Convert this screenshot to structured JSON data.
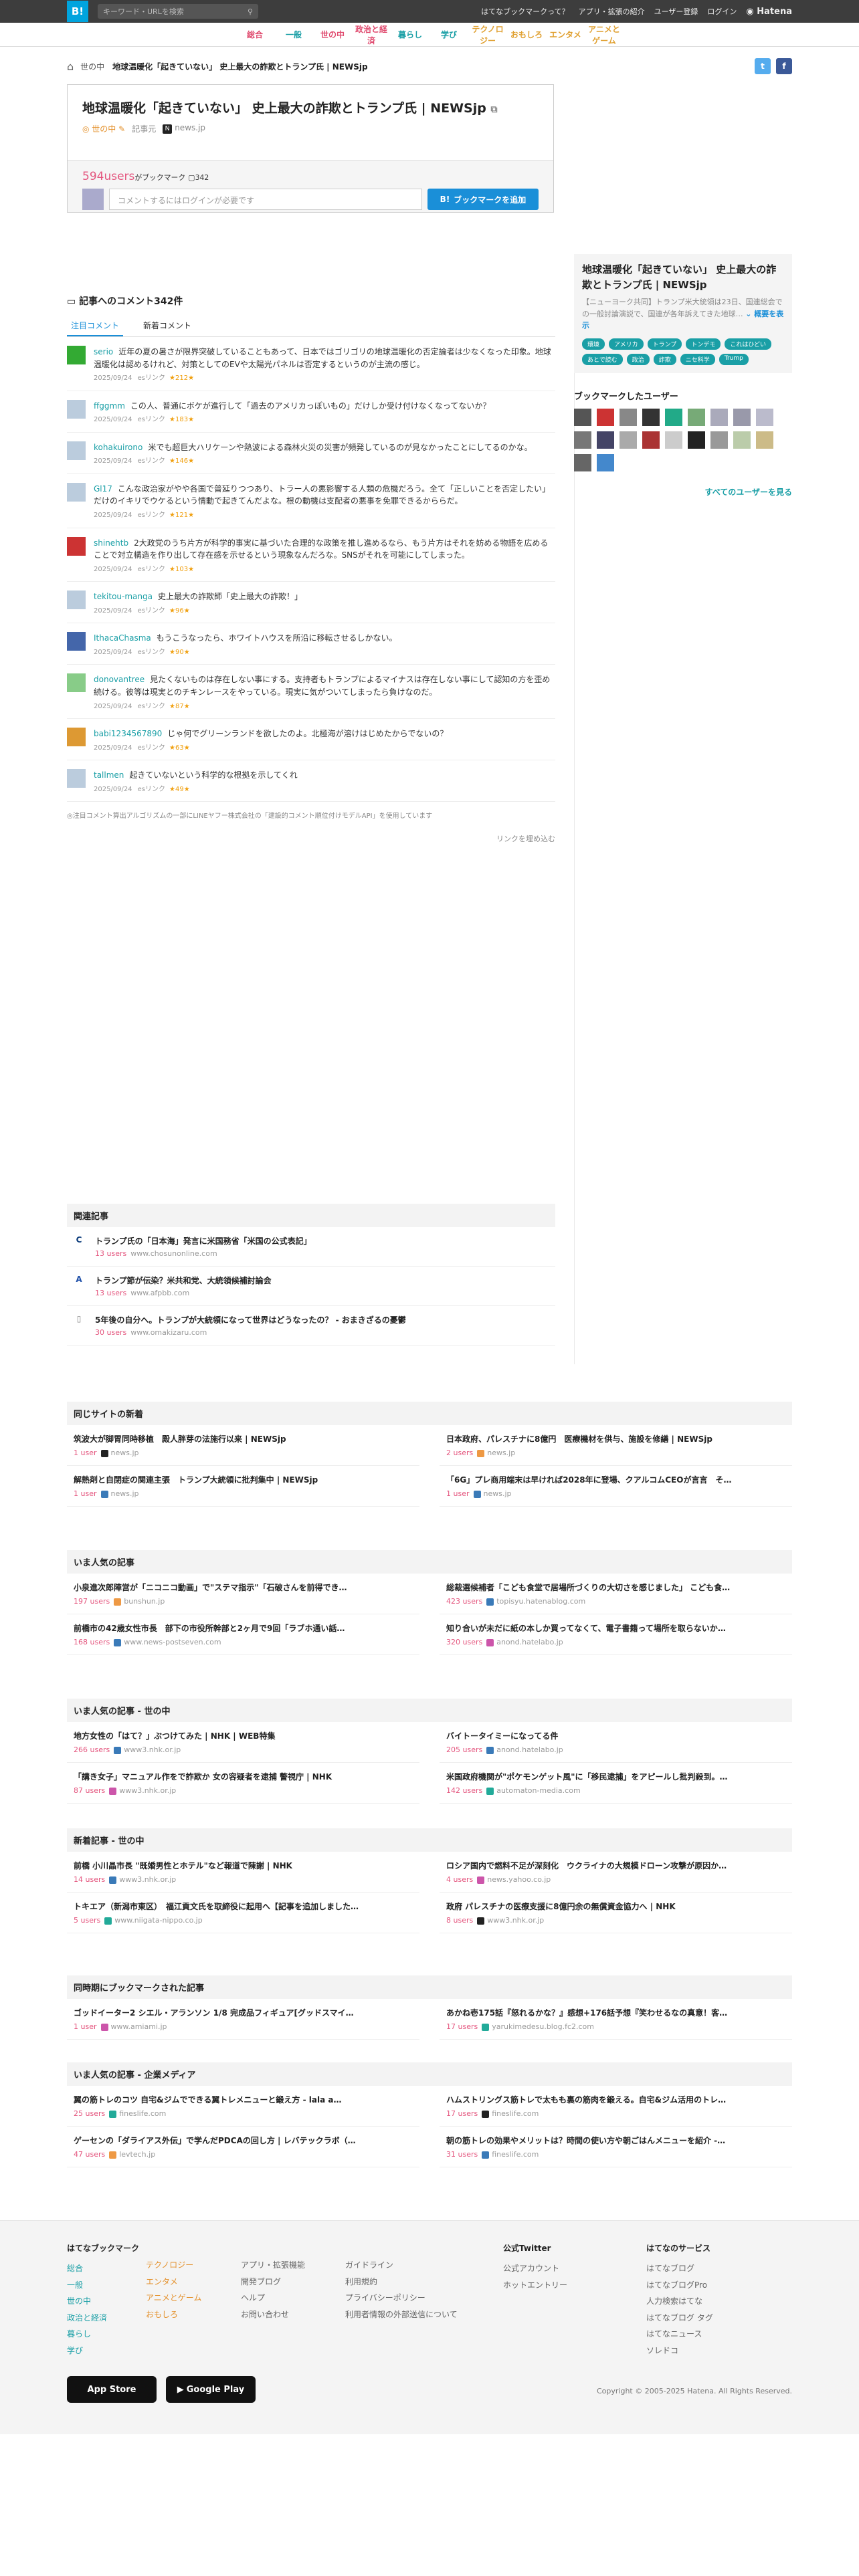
{
  "topbar": {
    "logo": "B!",
    "search_placeholder": "キーワード・URLを検索",
    "links": [
      "はてなブックマークって？",
      "アプリ・拡張の紹介",
      "ユーザー登録",
      "ログイン"
    ],
    "hatena": "Hatena"
  },
  "categories": [
    "総合",
    "一般",
    "世の中",
    "政治と経済",
    "暮らし",
    "学び",
    "テクノロジー",
    "おもしろ",
    "エンタメ",
    "アニメとゲーム"
  ],
  "category_colors": [
    "#e04b6f",
    "#1a9fa6",
    "#e04b6f",
    "#e04b6f",
    "#1a9fa6",
    "#1a9fa6",
    "#e0a030",
    "#e0a030",
    "#e0a030",
    "#e0a030"
  ],
  "breadcrumb": {
    "crumb": "世の中",
    "title": "地球温暖化「起きていない」 史上最大の詐欺とトランプ氏 | NEWSjp"
  },
  "article": {
    "title": "地球温暖化「起きていない」 史上最大の詐欺とトランプ氏 | NEWSjp",
    "category": "世の中",
    "kijichu": "記事元",
    "source": "news.jp",
    "users": "594users",
    "users_label": "がブックマーク",
    "comment_count": "342",
    "comment_placeholder": "コメントするにはログインが必要です",
    "add_button": "ブックマークを追加"
  },
  "sidebar": {
    "title": "地球温暖化「起きていない」 史上最大の詐欺とトランプ氏 | NEWSjp",
    "summary": "【ニューヨーク共同】トランプ米大統領は23日、国連総会での一般討論演説で、国連が各年訴えてきた地球…",
    "summary_link": "概要を表示",
    "tags": [
      "環境",
      "アメリカ",
      "トランプ",
      "トンデモ",
      "これはひどい",
      "あとで読む",
      "政治",
      "詐欺",
      "ニセ科学",
      "Trump"
    ],
    "users_heading": "ブックマークしたユーザー",
    "see_all": "すべてのユーザーを見る"
  },
  "comments": {
    "heading": "記事へのコメント342件",
    "tabs": [
      "注目コメント",
      "新着コメント"
    ],
    "items": [
      {
        "user": "serio",
        "text": "近年の夏の暑さが限界突破していることもあって、日本ではゴリゴリの地球温暖化の否定論者は少なくなった印象。地球温暖化は認めるけれど、対策としてのEVや太陽光パネルは否定するというのが主流の感じ。",
        "date": "2025/09/24",
        "stars": "★212★"
      },
      {
        "user": "ffggmm",
        "text": "この人、普通にボケが進行して「過去のアメリカっぽいもの」だけしか受け付けなくなってないか？",
        "date": "2025/09/24",
        "stars": "★183★"
      },
      {
        "user": "kohakuirono",
        "text": "米でも超巨大ハリケーンや熱波による森林火災の災害が頻発しているのが見なかったことにしてるのかな。",
        "date": "2025/09/24",
        "stars": "★146★"
      },
      {
        "user": "Gl17",
        "text": "こんな政治家がやや各国で普延りつつあり、トラー人の悪影響する人類の危機だろう。全て「正しいことを否定したい」だけのイキリでウケるという情動で起きてんだよな。根の動機は支配者の悪事を免罪できるかららだ。",
        "date": "2025/09/24",
        "stars": "★121★"
      },
      {
        "user": "shinehtb",
        "text": "2大政党のうち片方が科学的事実に基づいた合理的な政策を推し進めるなら、もう片方はそれを妨める物語を広めることで対立構造を作り出して存在感を示せるという現象なんだろな。SNSがそれを可能にしてしまった。",
        "date": "2025/09/24",
        "stars": "★103★"
      },
      {
        "user": "tekitou-manga",
        "text": "史上最大の詐欺師「史上最大の詐欺！」",
        "date": "2025/09/24",
        "stars": "★96★"
      },
      {
        "user": "IthacaChasma",
        "text": "もうこうなったら、ホワイトハウスを所沿に移転させるしかない。",
        "date": "2025/09/24",
        "stars": "★90★"
      },
      {
        "user": "donovantree",
        "text": "見たくないものは存在しない事にする。支持者もトランプによるマイナスは存在しない事にして認知の方を歪め続ける。彼等は現実とのチキンレースをやっている。現実に気がついてしまったら負けなのだ。",
        "date": "2025/09/24",
        "stars": "★87★"
      },
      {
        "user": "babi1234567890",
        "text": "じゃ何でグリーンランドを欲したのよ。北極海が溶けはじめたからでないの？",
        "date": "2025/09/24",
        "stars": "★63★"
      },
      {
        "user": "tallmen",
        "text": "起きていないという科学的な根拠を示してくれ",
        "date": "2025/09/24",
        "stars": "★49★"
      }
    ],
    "link_label": "esリンク",
    "note": "◎注目コメント算出アルゴリズムの一部にLINEヤフー株式会社の「建設的コメント順位付けモデルAPI」を使用しています",
    "more": "リンクを埋め込む"
  },
  "related": {
    "heading": "関連記事",
    "items": [
      {
        "title": "トランプ氏の「日本海」発言に米国務省「米国の公式表記」",
        "users": "13 users",
        "site": "www.chosunonline.com"
      },
      {
        "title": "トランプ節が伝染？米共和党、大統領候補討論会",
        "users": "13 users",
        "site": "www.afpbb.com"
      },
      {
        "title": "5年後の自分へ。トランプが大統領になって世界はどうなったの？ - おまきざるの憂鬱",
        "users": "30 users",
        "site": "www.omakizaru.com"
      }
    ]
  },
  "sections": [
    {
      "heading": "同じサイトの新着",
      "items": [
        {
          "title": "筑波大が脚胃同時移植　殿人胖芽の法施行以来 | NEWSjp",
          "users": "1 user",
          "site": "news.jp"
        },
        {
          "title": "日本政府、パレスチナに8億円　医療機材を供与、施設を修繕 | NEWSjp",
          "users": "2 users",
          "site": "news.jp"
        },
        {
          "title": "解熱剤と自閉症の関連主張　トランプ大統領に批判集中 | NEWSjp",
          "users": "1 user",
          "site": "news.jp"
        },
        {
          "title": "「6G」プレ商用端末は早ければ2028年に登場、クアルコムCEOが言言　そ…",
          "users": "1 user",
          "site": "news.jp"
        }
      ]
    },
    {
      "heading": "いま人気の記事",
      "items": [
        {
          "title": "小泉進次郎陣営が「ニコニコ動画」で\"ステマ指示\"「石破さんを前得でき…",
          "users": "197 users",
          "site": "bunshun.jp"
        },
        {
          "title": "総裁選候補者「こども食堂で居場所づくりの大切さを感じました」 こども食…",
          "users": "423 users",
          "site": "topisyu.hatenablog.com"
        },
        {
          "title": "前橋市の42歳女性市長　部下の市役所幹部と2ヶ月で9回「ラブホ通い話…",
          "users": "168 users",
          "site": "www.news-postseven.com"
        },
        {
          "title": "知り合いが未だに紙の本しか買ってなくて、電子書籍って場所を取らないか…",
          "users": "320 users",
          "site": "anond.hatelabo.jp"
        }
      ]
    },
    {
      "heading": "いま人気の記事 - 世の中",
      "items": [
        {
          "title": "地方女性の「はて？」ぶつけてみた | NHK | WEB特集",
          "users": "266 users",
          "site": "www3.nhk.or.jp"
        },
        {
          "title": "バイトータイミーになってる件",
          "users": "205 users",
          "site": "anond.hatelabo.jp"
        },
        {
          "title": "「講き女子」マニュアル作をで詐欺か 女の容疑者を逮捕 警視庁 | NHK",
          "users": "87 users",
          "site": "www3.nhk.or.jp"
        },
        {
          "title": "米国政府機関が\"ポケモンゲット風\"に「移民逮捕」をアピールし批判殺到。…",
          "users": "142 users",
          "site": "automaton-media.com"
        }
      ]
    },
    {
      "heading": "新着記事 - 世の中",
      "items": [
        {
          "title": "前橋 小川晶市長 \"既婚男性とホテル\"など報道で陳謝 | NHK",
          "users": "14 users",
          "site": "www3.nhk.or.jp"
        },
        {
          "title": "ロシア国内で燃料不足が深刻化　ウクライナの大規模ドローン攻撃が原因か…",
          "users": "4 users",
          "site": "news.yahoo.co.jp"
        },
        {
          "title": "トキエア（新潟市東区）　福江貢文氏を取締役に起用へ【記事を追加しました…",
          "users": "5 users",
          "site": "www.niigata-nippo.co.jp"
        },
        {
          "title": "政府 パレスチナの医療支援に8億円余の無償資金協力へ | NHK",
          "users": "8 users",
          "site": "www3.nhk.or.jp"
        }
      ]
    },
    {
      "heading": "同時期にブックマークされた記事",
      "items": [
        {
          "title": "ゴッドイーター2 シエル・アランソン 1/8 完成品フィギュア[グッドスマイ…",
          "users": "1 user",
          "site": "www.amiami.jp"
        },
        {
          "title": "あかね壱175話『怒れるかな？』感想+176話予想『笑わせるなの真意！客…",
          "users": "17 users",
          "site": "yarukimedesu.blog.fc2.com"
        }
      ]
    },
    {
      "heading": "いま人気の記事 - 企業メディア",
      "items": [
        {
          "title": "翼の筋トレのコツ 自宅&ジムでできる翼トレメニューと鍛え方 - lala a…",
          "users": "25 users",
          "site": "fineslife.com"
        },
        {
          "title": "ハムストリングス筋トレで太もも裏の筋肉を鍛える。自宅&ジム活用のトレ…",
          "users": "17 users",
          "site": "fineslife.com"
        },
        {
          "title": "ゲーセンの「ダライアス外伝」で学んだPDCAの回し方 | レバテックラボ（…",
          "users": "47 users",
          "site": "levtech.jp"
        },
        {
          "title": "朝の筋トレの効果やメリットは？時間の使い方や朝ごはんメニューを紹介 -…",
          "users": "31 users",
          "site": "fineslife.com"
        }
      ]
    }
  ],
  "footer": {
    "col1_heading": "はてなブックマーク",
    "col1a": [
      "総合",
      "一般",
      "世の中",
      "政治と経済",
      "暮らし",
      "学び"
    ],
    "col1b": [
      "テクノロジー",
      "エンタメ",
      "アニメとゲーム",
      "おもしろ"
    ],
    "col2": [
      "アプリ・拡張機能",
      "開発ブログ",
      "ヘルプ",
      "お問い合わせ"
    ],
    "col3": [
      "ガイドライン",
      "利用規約",
      "プライバシーポリシー",
      "利用者情報の外部送信について"
    ],
    "col4_heading": "公式Twitter",
    "col4": [
      "公式アカウント",
      "ホットエントリー"
    ],
    "col5_heading": "はてなのサービス",
    "col5": [
      "はてなブログ",
      "はてなブログPro",
      "人力検索はてな",
      "はてなブログ タグ",
      "はてなニュース",
      "ソレドコ"
    ],
    "appstore": "App Store",
    "googleplay": "Google Play",
    "copyright": "Copyright © 2005-2025 Hatena. All Rights Reserved."
  }
}
